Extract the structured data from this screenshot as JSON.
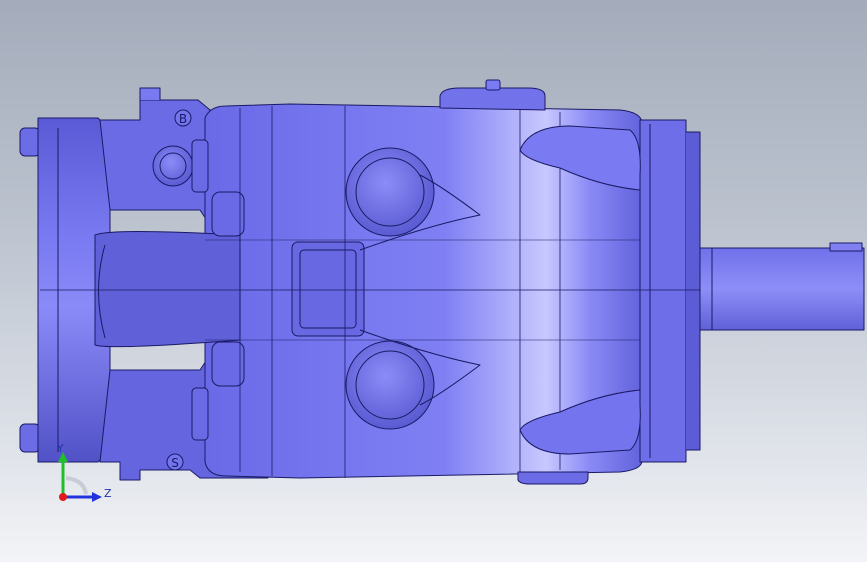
{
  "viewport": {
    "background_top": "#a4acbb",
    "background_bottom": "#f3f4f7",
    "model_color": "#6f6fee",
    "edge_color": "#1a1a66"
  },
  "model": {
    "port_top_label": "B",
    "port_bottom_label": "S"
  },
  "triad": {
    "y_label": "Y",
    "z_label": "Z",
    "y_color": "#1fbf2a",
    "z_color": "#2233dd",
    "origin_color": "#e01b1b"
  }
}
